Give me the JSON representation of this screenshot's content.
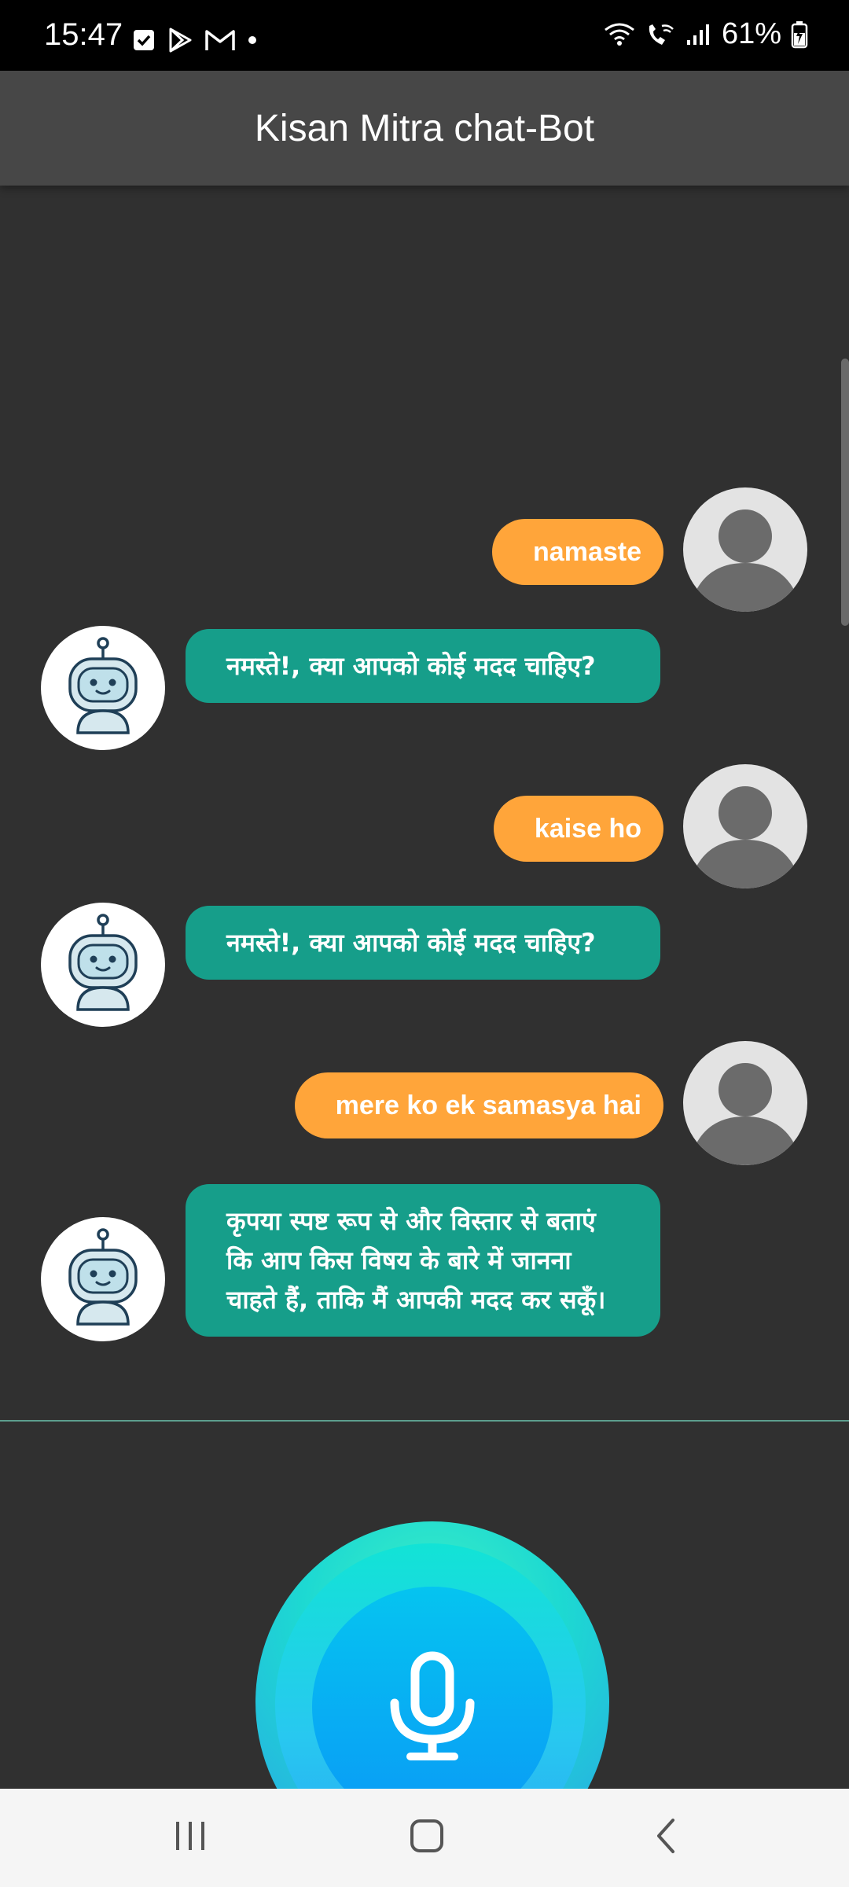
{
  "status_bar": {
    "time": "15:47",
    "battery": "61%",
    "left_icons": [
      "checkbox-icon",
      "play-store-icon",
      "gmail-icon",
      "dot-icon"
    ],
    "right_icons": [
      "wifi-icon",
      "wifi-call-icon",
      "signal-icon",
      "battery-icon"
    ]
  },
  "app_bar": {
    "title": "Kisan Mitra chat-Bot"
  },
  "messages": [
    {
      "sender": "user",
      "text": "namaste"
    },
    {
      "sender": "bot",
      "text": "नमस्ते!, क्या आपको कोई मदद चाहिए?"
    },
    {
      "sender": "user",
      "text": "kaise ho"
    },
    {
      "sender": "bot",
      "text": "नमस्ते!, क्या आपको कोई मदद चाहिए?"
    },
    {
      "sender": "user",
      "text": "mere ko ek samasya hai"
    },
    {
      "sender": "bot",
      "text": "कृपया स्पष्ट रूप से और विस्तार से बताएं कि आप किस विषय के बारे में जानना चाहते हैं, ताकि मैं आपकी मदद कर सकूँ।"
    }
  ],
  "colors": {
    "background": "#303030",
    "app_bar": "#474747",
    "user_bubble": "#ffa53a",
    "bot_bubble": "#169e8a",
    "mic_accent": "#05c4f0"
  },
  "mic": {
    "icon": "microphone-icon"
  },
  "nav_bar": {
    "icons": [
      "recent-apps-icon",
      "home-icon",
      "back-icon"
    ]
  }
}
